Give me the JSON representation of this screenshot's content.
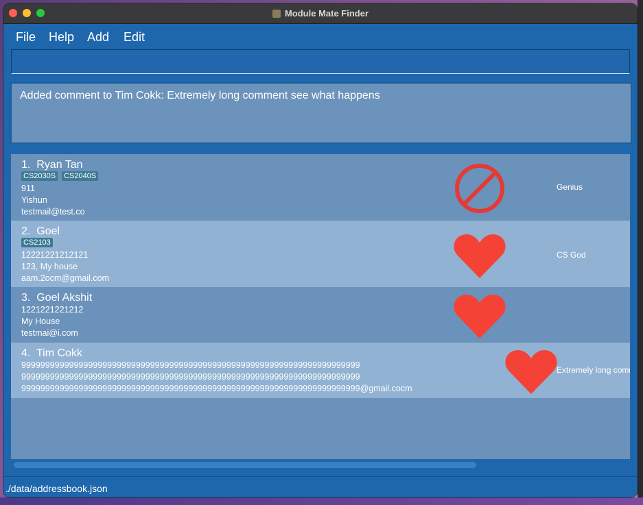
{
  "window": {
    "title": "Module Mate Finder"
  },
  "menu": [
    {
      "label": "File"
    },
    {
      "label": "Help"
    },
    {
      "label": "Add"
    },
    {
      "label": "Edit"
    }
  ],
  "command": {
    "value": "",
    "placeholder": ""
  },
  "result": {
    "message": "Added comment to Tim Cokk: Extremely long comment see what happens"
  },
  "persons": [
    {
      "index": "1.",
      "name": "Ryan Tan",
      "tags": [
        "CS2030S",
        "CS2040S"
      ],
      "phone": "911",
      "address": "Yishun",
      "email": "testmail@test.co",
      "status_icon": "prohibited-icon",
      "comment": "Genius"
    },
    {
      "index": "2.",
      "name": "Goel",
      "tags": [
        "CS2103"
      ],
      "phone": "12221221212121",
      "address": "123, My house",
      "email": "aam.2ocm@gmail.com",
      "status_icon": "heart-icon",
      "comment": "CS God"
    },
    {
      "index": "3.",
      "name": "Goel Akshit",
      "tags": [],
      "phone": "1221221221212",
      "address": "My House",
      "email": "testmai@i.com",
      "status_icon": "heart-icon",
      "comment": ""
    },
    {
      "index": "4.",
      "name": "Tim Cokk",
      "tags": [],
      "lines": [
        "99999999999999999999999999999999999999999999999999999999999999999999999",
        "99999999999999999999999999999999999999999999999999999999999999999999999",
        "99999999999999999999999999999999999999999999999999999999999999999999999@gmail.cocm"
      ],
      "status_icon": "heart-icon",
      "comment": "Extremely long comment see what happens"
    }
  ],
  "status": {
    "path": "./data/addressbook.json"
  },
  "colors": {
    "window_bg": "#1e67ad",
    "card_odd": "#6b92ba",
    "card_even": "#92b2d3",
    "tag_bg": "#3d7a94",
    "heart": "#f44336",
    "prohibited": "#e53935"
  }
}
